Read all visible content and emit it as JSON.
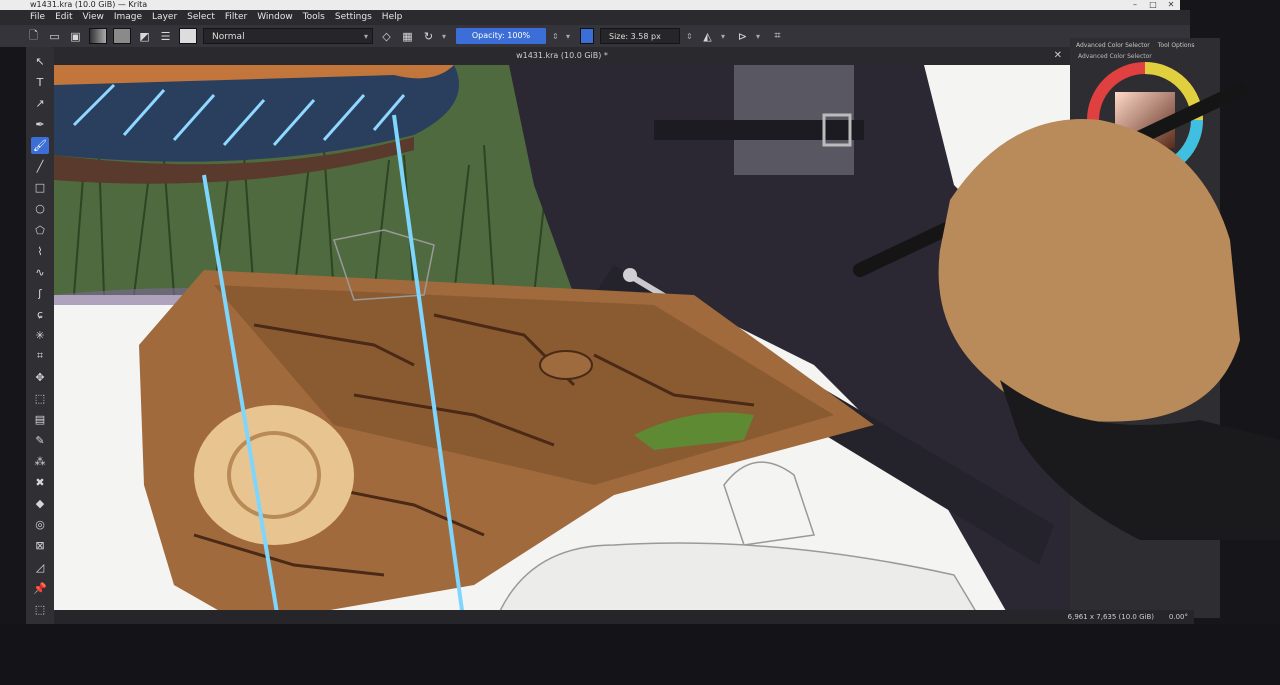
{
  "window": {
    "title": "w1431.kra (10.0 GiB) — Krita",
    "document_tab": "w1431.kra (10.0 GiB) *"
  },
  "menu": {
    "items": [
      "File",
      "Edit",
      "View",
      "Image",
      "Layer",
      "Select",
      "Filter",
      "Window",
      "Tools",
      "Settings",
      "Help"
    ]
  },
  "toolbar": {
    "blending_mode": "Normal",
    "opacity": "Opacity: 100%",
    "size": "Size: 3.58 px"
  },
  "dock": {
    "tabs": [
      "Advanced Color Selector",
      "Tool Options"
    ],
    "panel_title": "Advanced Color Selector"
  },
  "status": {
    "image_size": "6,961 x 7,635 (10.0 GiB)",
    "rotation": "0.00°"
  },
  "colors": {
    "accent": "#3b6ed6",
    "ui_bg": "#303034"
  }
}
